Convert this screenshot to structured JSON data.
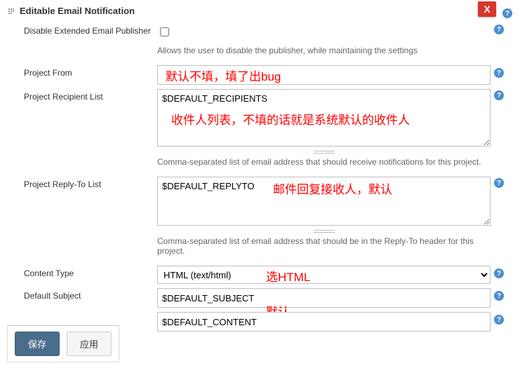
{
  "section": {
    "title": "Editable Email Notification"
  },
  "disablePublisher": {
    "label": "Disable Extended Email Publisher",
    "checked": false,
    "hint": "Allows the user to disable the publisher, while maintaining the settings"
  },
  "projectFrom": {
    "label": "Project From",
    "value": ""
  },
  "recipientList": {
    "label": "Project Recipient List",
    "value": "$DEFAULT_RECIPIENTS",
    "hint": "Comma-separated list of email address that should receive notifications for this project."
  },
  "replyToList": {
    "label": "Project Reply-To List",
    "value": "$DEFAULT_REPLYTO",
    "hint": "Comma-separated list of email address that should be in the Reply-To header for this project."
  },
  "contentType": {
    "label": "Content Type",
    "selected": "HTML (text/html)"
  },
  "defaultSubject": {
    "label": "Default Subject",
    "value": "$DEFAULT_SUBJECT"
  },
  "defaultContent": {
    "value": "$DEFAULT_CONTENT"
  },
  "buttons": {
    "save": "保存",
    "apply": "应用"
  },
  "annotations": {
    "projectFrom": "默认不填，填了出bug",
    "recipients": "收件人列表，不填的话就是系统默认的收件人",
    "replyTo": "邮件回复接收人，默认",
    "contentType": "选HTML",
    "subject": "默认"
  }
}
